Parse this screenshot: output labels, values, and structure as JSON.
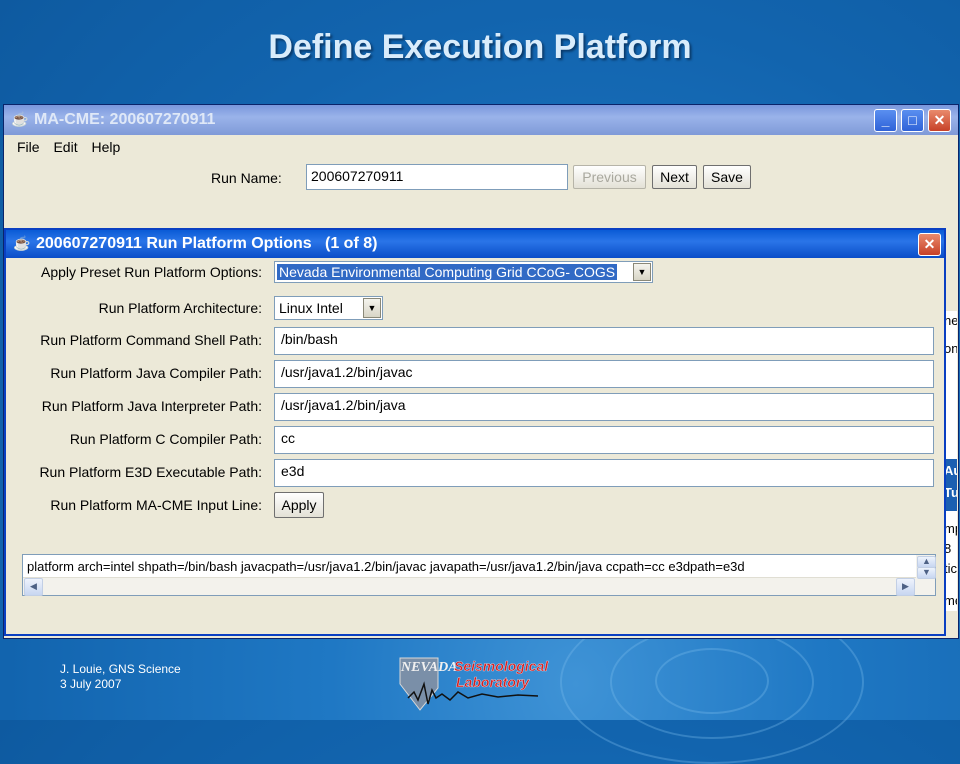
{
  "slide": {
    "title": "Define Execution Platform",
    "footer_line1": "J. Louie, GNS Science",
    "footer_line2": "3 July 2007",
    "logo_word1": "NEVADA",
    "logo_word2": "Seismological",
    "logo_word3": "Laboratory"
  },
  "main_window": {
    "title": "MA-CME: 200607270911",
    "menu": [
      "File",
      "Edit",
      "Help"
    ],
    "run_name_label": "Run Name:",
    "run_name_value": "200607270911",
    "previous_label": "Previous",
    "next_label": "Next",
    "save_label": "Save",
    "right_fragments": [
      "ne",
      "on",
      "Au",
      "Tu",
      "mp",
      "8",
      "tic",
      "me"
    ]
  },
  "dialog": {
    "title": "200607270911 Run Platform Options   (1 of 8)",
    "preset_label": "Apply Preset Run Platform Options:",
    "preset_value": "Nevada Environmental Computing Grid CCoG- COGS",
    "arch_label": "Run Platform Architecture:",
    "arch_value": "Linux Intel",
    "shell_label": "Run Platform Command Shell Path:",
    "shell_value": "/bin/bash",
    "javac_label": "Run Platform Java Compiler Path:",
    "javac_value": "/usr/java1.2/bin/javac",
    "java_label": "Run Platform Java Interpreter Path:",
    "java_value": "/usr/java1.2/bin/java",
    "cc_label": "Run Platform C Compiler Path:",
    "cc_value": "cc",
    "e3d_label": "Run Platform E3D Executable Path:",
    "e3d_value": "e3d",
    "input_line_label": "Run Platform MA-CME Input Line:",
    "apply_label": "Apply",
    "input_line_text": "platform arch=intel shpath=/bin/bash javacpath=/usr/java1.2/bin/javac javapath=/usr/java1.2/bin/java ccpath=cc e3dpath=e3d"
  },
  "colors": {
    "slide_bg": "#1264ae",
    "titlebar_active": "#0a5bd6",
    "titlebar_inactive": "#9ab3ea",
    "window_bg": "#ece9d8",
    "selection": "#316ac5"
  },
  "icons": [
    "java-cup-icon",
    "minimize-icon",
    "maximize-icon",
    "close-icon",
    "dropdown-arrow-icon",
    "scroll-left-icon",
    "scroll-right-icon",
    "scroll-up-icon",
    "scroll-down-icon"
  ]
}
